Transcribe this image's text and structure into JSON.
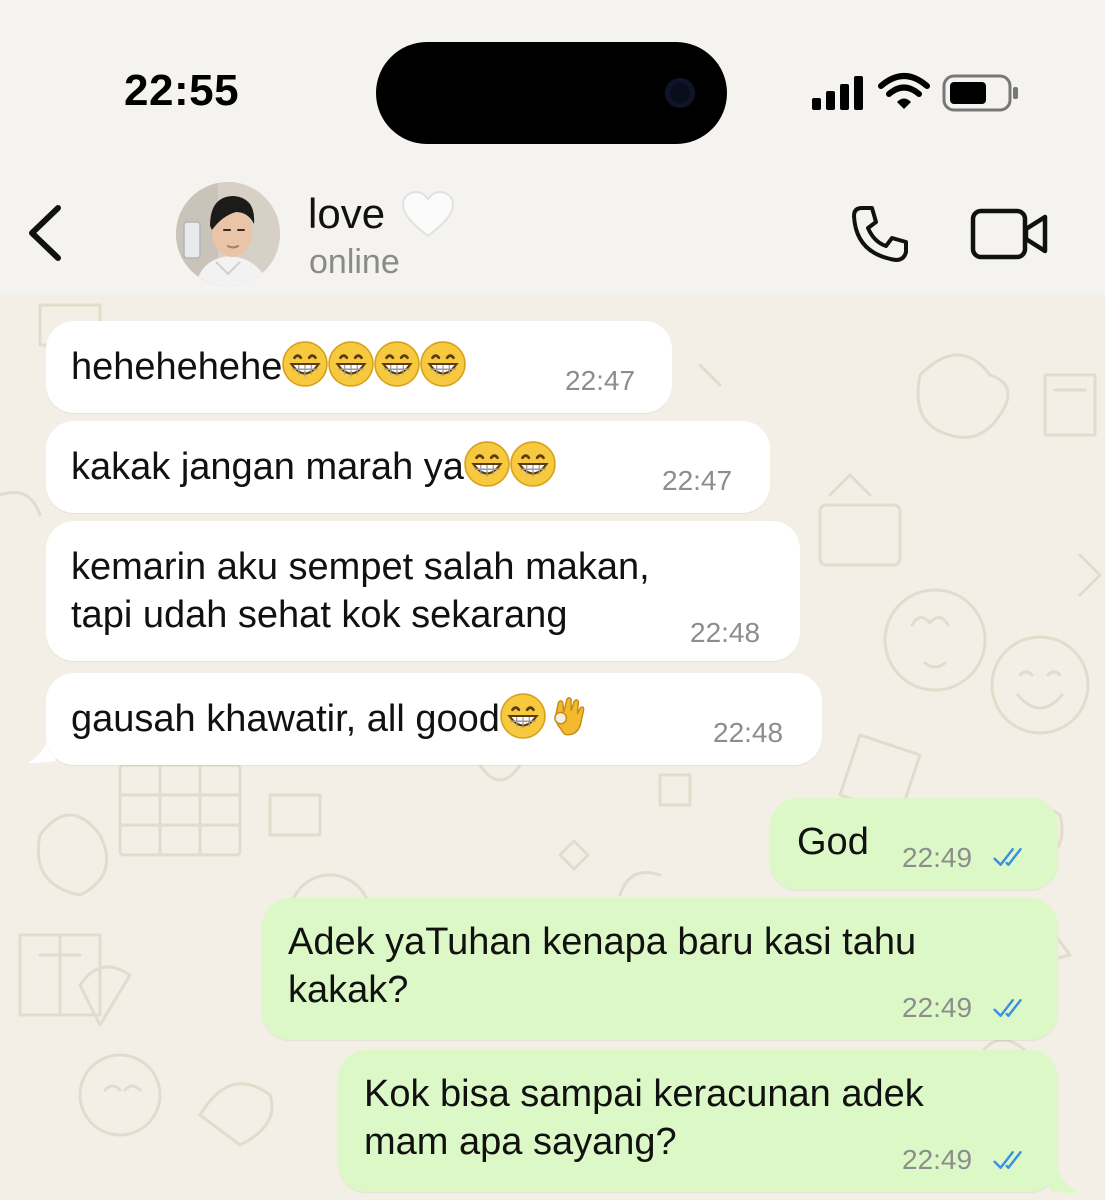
{
  "status_bar": {
    "time": "22:55",
    "icons": [
      "signal-icon",
      "wifi-icon",
      "battery-icon"
    ]
  },
  "header": {
    "contact_name": "love",
    "contact_emoji": "white-heart",
    "status": "online",
    "icons": [
      "back-chevron-icon",
      "avatar",
      "phone-icon",
      "video-camera-icon"
    ]
  },
  "colors": {
    "incoming_bubble": "#ffffff",
    "outgoing_bubble": "#dcf8c7",
    "chat_background": "#f3efe6",
    "read_ticks": "#3b8fe0"
  },
  "messages": [
    {
      "direction": "incoming",
      "text": "hehehehehe",
      "emoji": [
        "grin",
        "grin",
        "grin",
        "grin"
      ],
      "time": "22:47"
    },
    {
      "direction": "incoming",
      "text": "kakak jangan marah ya",
      "emoji": [
        "grin",
        "grin"
      ],
      "time": "22:47"
    },
    {
      "direction": "incoming",
      "text": "kemarin aku sempet salah makan,\ntapi udah sehat kok sekarang",
      "emoji": [],
      "time": "22:48"
    },
    {
      "direction": "incoming",
      "text": "gausah khawatir, all good",
      "emoji": [
        "grin",
        "ok-hand"
      ],
      "time": "22:48"
    },
    {
      "direction": "outgoing",
      "text": "God",
      "time": "22:49",
      "status": "read"
    },
    {
      "direction": "outgoing",
      "text": "Adek yaTuhan kenapa baru kasi tahu\nkakak?",
      "time": "22:49",
      "status": "read"
    },
    {
      "direction": "outgoing",
      "text": "Kok bisa sampai keracunan adek\nmam apa sayang?",
      "time": "22:49",
      "status": "read"
    }
  ]
}
